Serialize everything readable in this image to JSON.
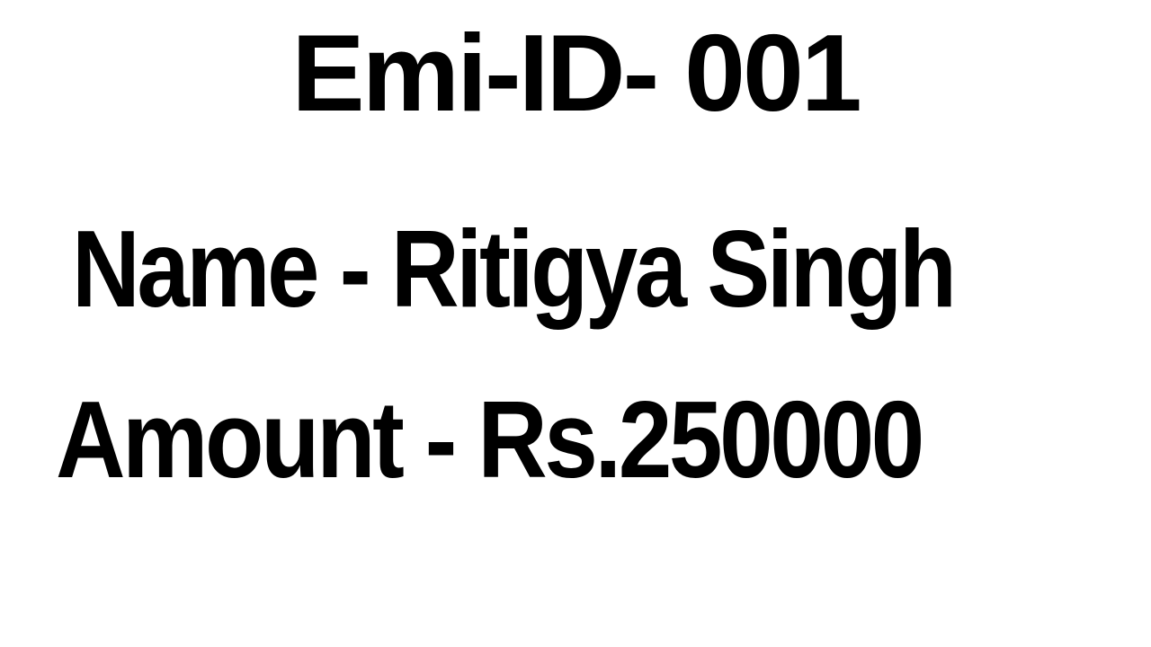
{
  "slide": {
    "emi_id": "Emi-ID- 001",
    "name": "Name - Ritigya Singh",
    "amount": "Amount - Rs.250000"
  }
}
